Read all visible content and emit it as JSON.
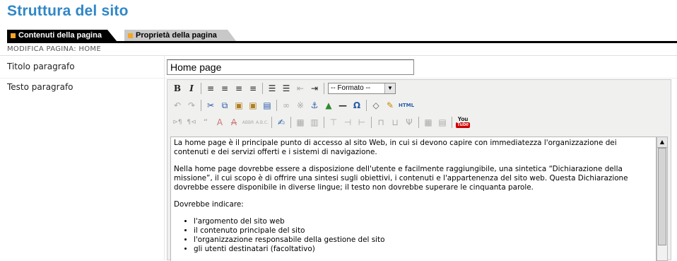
{
  "page": {
    "title": "Struttura del sito"
  },
  "tabs": [
    {
      "label": "Contenuti della pagina",
      "active": true
    },
    {
      "label": "Proprietà della pagina",
      "active": false
    }
  ],
  "breadcrumb": "MODIFICA PAGINA: HOME",
  "form": {
    "title_label": "Titolo paragrafo",
    "title_value": "Home page",
    "text_label": "Testo paragrafo"
  },
  "editor": {
    "format_select": "-- Formato --",
    "html_label": "HTML",
    "youtube_top": "You",
    "youtube_bottom": "Tube",
    "paragraphs": [
      "La home page è il principale punto di accesso al sito Web, in cui si devono capire con immediatezza l'organizzazione dei contenuti e dei servizi offerti e i sistemi di navigazione.",
      "Nella home page dovrebbe essere a disposizione dell'utente e facilmente raggiungibile, una sintetica “Dichiarazione della missione”, il cui scopo è di offrire una sintesi sugli obiettivi, i contenuti e l'appartenenza del sito web. Questa Dichiarazione dovrebbe essere disponibile in diverse lingue; il testo non dovrebbe superare le cinquanta parole.",
      "Dovrebbe indicare:"
    ],
    "bullets": [
      "l'argomento del sito web",
      "il contenuto principale del sito",
      "l'organizzazione responsabile della gestione del sito",
      "gli utenti destinatari (facoltativo)"
    ]
  },
  "colors": {
    "title": "#2f87c6",
    "tab_marker": "#f5a623",
    "active_tab": "#000000",
    "inactive_tab": "#c8c8c8"
  }
}
